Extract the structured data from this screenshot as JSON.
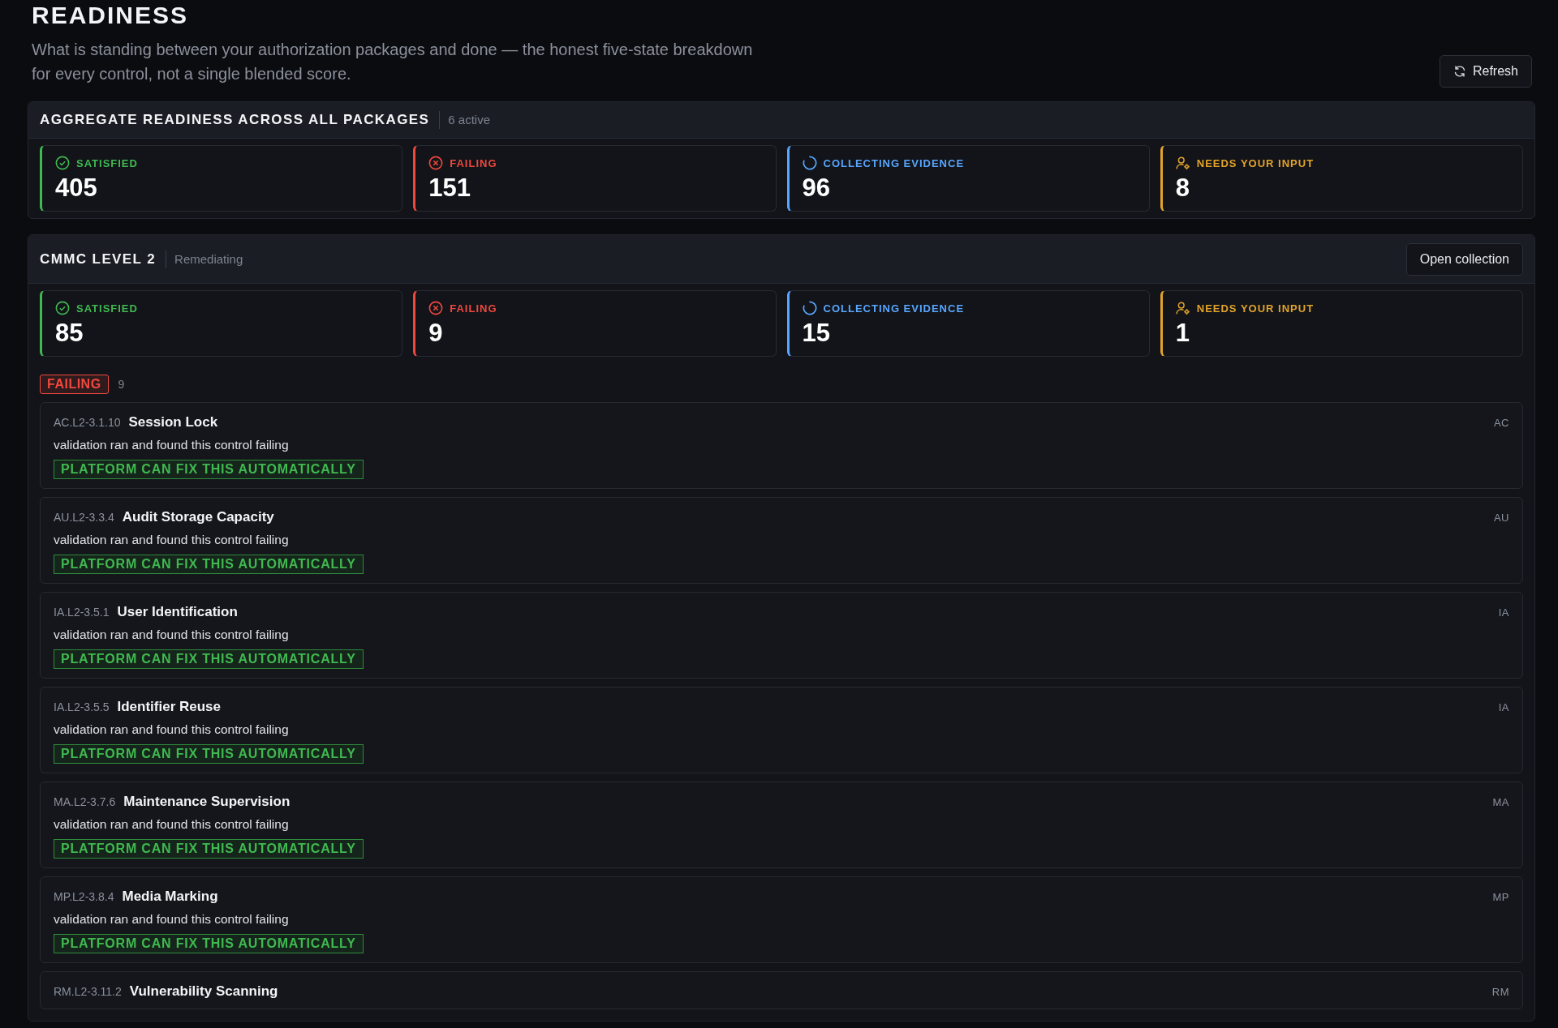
{
  "page": {
    "title": "READINESS",
    "subtitle": "What is standing between your authorization packages and done — the honest five-state breakdown for every control, not a single blended score.",
    "refresh_button": "Refresh"
  },
  "packages": [
    {
      "title": "AGGREGATE READINESS ACROSS ALL PACKAGES",
      "subtitle": "6 active",
      "stats": [
        {
          "kind": "satisfied",
          "label": "SATISFIED",
          "value": "405"
        },
        {
          "kind": "failing",
          "label": "FAILING",
          "value": "151"
        },
        {
          "kind": "collecting",
          "label": "COLLECTING EVIDENCE",
          "value": "96"
        },
        {
          "kind": "input",
          "label": "NEEDS YOUR INPUT",
          "value": "8"
        }
      ]
    },
    {
      "title": "CMMC LEVEL 2",
      "subtitle": "Remediating",
      "button": "Open collection",
      "stats": [
        {
          "kind": "satisfied",
          "label": "SATISFIED",
          "value": "85"
        },
        {
          "kind": "failing",
          "label": "FAILING",
          "value": "9"
        },
        {
          "kind": "collecting",
          "label": "COLLECTING EVIDENCE",
          "value": "15"
        },
        {
          "kind": "input",
          "label": "NEEDS YOUR INPUT",
          "value": "1"
        }
      ],
      "group": {
        "kind": "failing",
        "label": "FAILING",
        "count": "9",
        "controls": [
          {
            "code": "AC.L2-3.1.10",
            "name": "Session Lock",
            "description": "validation ran and found this control failing",
            "badge": "PLATFORM CAN FIX THIS AUTOMATICALLY",
            "family": "AC"
          },
          {
            "code": "AU.L2-3.3.4",
            "name": "Audit Storage Capacity",
            "description": "validation ran and found this control failing",
            "badge": "PLATFORM CAN FIX THIS AUTOMATICALLY",
            "family": "AU"
          },
          {
            "code": "IA.L2-3.5.1",
            "name": "User Identification",
            "description": "validation ran and found this control failing",
            "badge": "PLATFORM CAN FIX THIS AUTOMATICALLY",
            "family": "IA"
          },
          {
            "code": "IA.L2-3.5.5",
            "name": "Identifier Reuse",
            "description": "validation ran and found this control failing",
            "badge": "PLATFORM CAN FIX THIS AUTOMATICALLY",
            "family": "IA"
          },
          {
            "code": "MA.L2-3.7.6",
            "name": "Maintenance Supervision",
            "description": "validation ran and found this control failing",
            "badge": "PLATFORM CAN FIX THIS AUTOMATICALLY",
            "family": "MA"
          },
          {
            "code": "MP.L2-3.8.4",
            "name": "Media Marking",
            "description": "validation ran and found this control failing",
            "badge": "PLATFORM CAN FIX THIS AUTOMATICALLY",
            "family": "MP"
          },
          {
            "code": "RM.L2-3.11.2",
            "name": "Vulnerability Scanning",
            "family": "RM"
          }
        ]
      }
    }
  ]
}
